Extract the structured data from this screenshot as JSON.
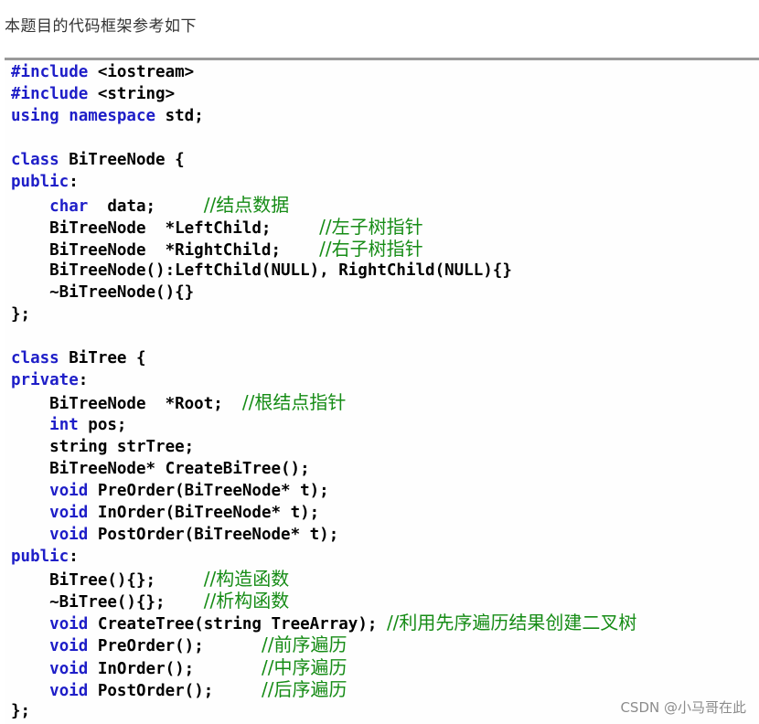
{
  "intro_text": "本题目的代码框架参考如下",
  "code": {
    "lines": [
      [
        {
          "t": "#include",
          "c": "kw"
        },
        {
          "t": " <iostream>",
          "c": "plain"
        }
      ],
      [
        {
          "t": "#include",
          "c": "kw"
        },
        {
          "t": " <string>",
          "c": "plain"
        }
      ],
      [
        {
          "t": "using namespace",
          "c": "kw"
        },
        {
          "t": " std;",
          "c": "plain"
        }
      ],
      [],
      [
        {
          "t": "class",
          "c": "kw"
        },
        {
          "t": " BiTreeNode {",
          "c": "plain"
        }
      ],
      [
        {
          "t": "public",
          "c": "kw"
        },
        {
          "t": ":",
          "c": "plain"
        }
      ],
      [
        {
          "t": "    ",
          "c": "plain"
        },
        {
          "t": "char",
          "c": "kw"
        },
        {
          "t": "  data;     ",
          "c": "plain"
        },
        {
          "t": "//结点数据",
          "c": "cm"
        }
      ],
      [
        {
          "t": "    BiTreeNode  *LeftChild;     ",
          "c": "plain"
        },
        {
          "t": "//左子树指针",
          "c": "cm"
        }
      ],
      [
        {
          "t": "    BiTreeNode  *RightChild;    ",
          "c": "plain"
        },
        {
          "t": "//右子树指针",
          "c": "cm"
        }
      ],
      [
        {
          "t": "    BiTreeNode():LeftChild(NULL), RightChild(NULL){}",
          "c": "plain"
        }
      ],
      [
        {
          "t": "    ~BiTreeNode(){}",
          "c": "plain"
        }
      ],
      [
        {
          "t": "};",
          "c": "plain"
        }
      ],
      [],
      [
        {
          "t": "class",
          "c": "kw"
        },
        {
          "t": " BiTree {",
          "c": "plain"
        }
      ],
      [
        {
          "t": "private",
          "c": "kw"
        },
        {
          "t": ":",
          "c": "plain"
        }
      ],
      [
        {
          "t": "    BiTreeNode  *Root;  ",
          "c": "plain"
        },
        {
          "t": "//根结点指针",
          "c": "cm"
        }
      ],
      [
        {
          "t": "    ",
          "c": "plain"
        },
        {
          "t": "int",
          "c": "kw"
        },
        {
          "t": " pos;",
          "c": "plain"
        }
      ],
      [
        {
          "t": "    string strTree;",
          "c": "plain"
        }
      ],
      [
        {
          "t": "    BiTreeNode* CreateBiTree();",
          "c": "plain"
        }
      ],
      [
        {
          "t": "    ",
          "c": "plain"
        },
        {
          "t": "void",
          "c": "kw"
        },
        {
          "t": " PreOrder(BiTreeNode* t);",
          "c": "plain"
        }
      ],
      [
        {
          "t": "    ",
          "c": "plain"
        },
        {
          "t": "void",
          "c": "kw"
        },
        {
          "t": " InOrder(BiTreeNode* t);",
          "c": "plain"
        }
      ],
      [
        {
          "t": "    ",
          "c": "plain"
        },
        {
          "t": "void",
          "c": "kw"
        },
        {
          "t": " PostOrder(BiTreeNode* t);",
          "c": "plain"
        }
      ],
      [
        {
          "t": "public",
          "c": "kw"
        },
        {
          "t": ":",
          "c": "plain"
        }
      ],
      [
        {
          "t": "    BiTree(){};     ",
          "c": "plain"
        },
        {
          "t": "//构造函数",
          "c": "cm"
        }
      ],
      [
        {
          "t": "    ~BiTree(){};    ",
          "c": "plain"
        },
        {
          "t": "//析构函数",
          "c": "cm"
        }
      ],
      [
        {
          "t": "    ",
          "c": "plain"
        },
        {
          "t": "void",
          "c": "kw"
        },
        {
          "t": " CreateTree(string TreeArray); ",
          "c": "plain"
        },
        {
          "t": "//利用先序遍历结果创建二叉树",
          "c": "cm"
        }
      ],
      [
        {
          "t": "    ",
          "c": "plain"
        },
        {
          "t": "void",
          "c": "kw"
        },
        {
          "t": " PreOrder();      ",
          "c": "plain"
        },
        {
          "t": "//前序遍历",
          "c": "cm"
        }
      ],
      [
        {
          "t": "    ",
          "c": "plain"
        },
        {
          "t": "void",
          "c": "kw"
        },
        {
          "t": " InOrder();       ",
          "c": "plain"
        },
        {
          "t": "//中序遍历",
          "c": "cm"
        }
      ],
      [
        {
          "t": "    ",
          "c": "plain"
        },
        {
          "t": "void",
          "c": "kw"
        },
        {
          "t": " PostOrder();     ",
          "c": "plain"
        },
        {
          "t": "//后序遍历",
          "c": "cm"
        }
      ],
      [
        {
          "t": "};",
          "c": "plain"
        }
      ]
    ]
  },
  "watermark": "CSDN @小马哥在此",
  "colors": {
    "keyword": "#1e1ec8",
    "comment": "#168c16",
    "text": "#000000",
    "border": "#9a9a9a"
  }
}
